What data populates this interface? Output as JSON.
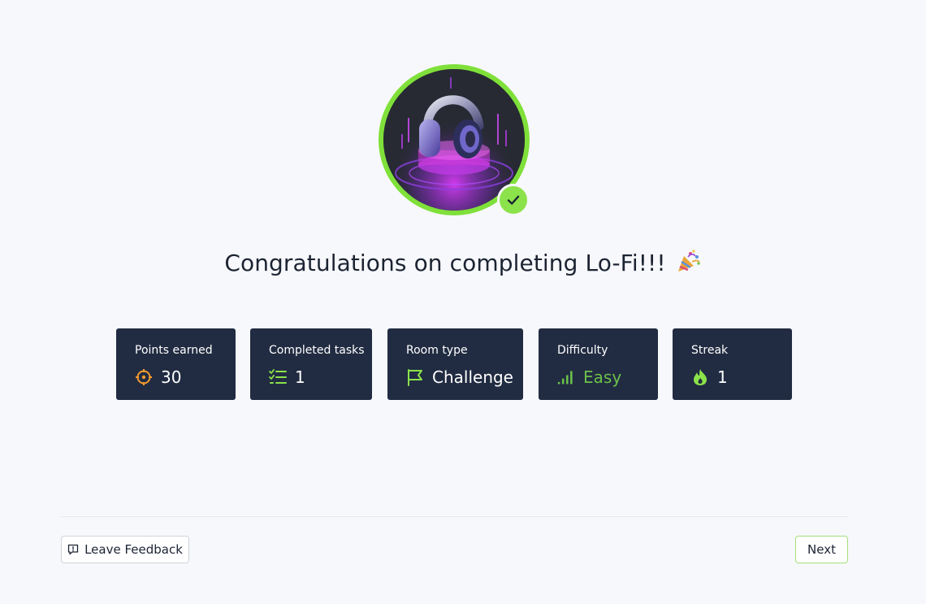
{
  "room": {
    "image_icon": "headphones-image",
    "badge_icon": "check-icon",
    "accent_color": "#7fe03a"
  },
  "title": {
    "text": "Congratulations on completing Lo-Fi!!!",
    "emoji": "🎉"
  },
  "stats": [
    {
      "label": "Points earned",
      "value": "30",
      "icon": "target-icon",
      "icon_color": "#f29a2e"
    },
    {
      "label": "Completed tasks",
      "value": "1",
      "icon": "checklist-icon",
      "icon_color": "#8be24a"
    },
    {
      "label": "Room type",
      "value": "Challenge",
      "icon": "flag-icon",
      "icon_color": "#8be24a"
    },
    {
      "label": "Difficulty",
      "value": "Easy",
      "icon": "signal-bars-icon",
      "icon_color": "#6cc04a"
    },
    {
      "label": "Streak",
      "value": "1",
      "icon": "flame-icon",
      "icon_color": "#8be24a"
    }
  ],
  "footer": {
    "feedback_label": "Leave Feedback",
    "feedback_icon": "message-icon",
    "next_label": "Next"
  },
  "colors": {
    "card_bg": "#212c42",
    "page_bg": "#f7f8fb",
    "easy": "#6cc04a"
  }
}
